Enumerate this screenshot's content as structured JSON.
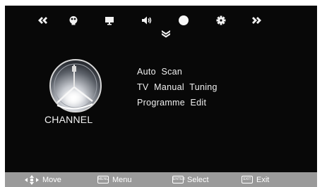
{
  "menu": {
    "tabs": [
      {
        "icon": "prev-arrow-icon"
      },
      {
        "icon": "picture-icon"
      },
      {
        "icon": "screen-icon"
      },
      {
        "icon": "speaker-icon"
      },
      {
        "icon": "channel-icon",
        "active": true
      },
      {
        "icon": "gear-icon"
      },
      {
        "icon": "next-arrow-icon"
      }
    ],
    "section_title": "CHANNEL",
    "items": [
      "Auto  Scan",
      "TV  Manual  Tuning",
      "Programme  Edit"
    ]
  },
  "statusbar": {
    "move": "Move",
    "menu": "Menu",
    "select": "Select",
    "exit": "Exit",
    "menu_key": "MENU",
    "select_key": "ENTER",
    "exit_key": "EXIT"
  },
  "colors": {
    "background": "#080808",
    "text": "#f0f0f0",
    "statusbar": "#9a9a9a"
  }
}
